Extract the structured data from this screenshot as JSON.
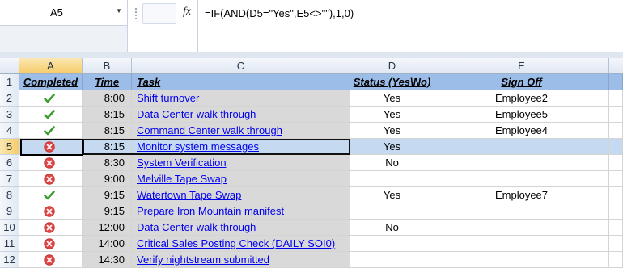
{
  "formula_bar": {
    "name_box": "A5",
    "fx_label": "fx",
    "formula": "=IF(AND(D5=\"Yes\",E5<>\"\"),1,0)"
  },
  "columns": [
    "A",
    "B",
    "C",
    "D",
    "E"
  ],
  "header_row": {
    "row_number": "1",
    "completed": "Completed",
    "time": "Time",
    "task": "Task",
    "status": "Status (Yes\\No)",
    "sign_off": "Sign Off"
  },
  "rows": [
    {
      "num": "2",
      "icon": "check",
      "time": "8:00",
      "task": "Shift turnover",
      "status": "Yes",
      "signoff": "Employee2"
    },
    {
      "num": "3",
      "icon": "check",
      "time": "8:15",
      "task": "Data Center walk through",
      "status": "Yes",
      "signoff": "Employee5"
    },
    {
      "num": "4",
      "icon": "check",
      "time": "8:15",
      "task": "Command Center walk through",
      "status": "Yes",
      "signoff": "Employee4"
    },
    {
      "num": "5",
      "icon": "x",
      "time": "8:15",
      "task": "Monitor system messages",
      "status": "Yes",
      "signoff": ""
    },
    {
      "num": "6",
      "icon": "x",
      "time": "8:30",
      "task": "System Verification",
      "status": "No",
      "signoff": ""
    },
    {
      "num": "7",
      "icon": "x",
      "time": "9:00",
      "task": "Melville Tape Swap",
      "status": "",
      "signoff": ""
    },
    {
      "num": "8",
      "icon": "check",
      "time": "9:15",
      "task": "Watertown Tape Swap",
      "status": "Yes",
      "signoff": "Employee7"
    },
    {
      "num": "9",
      "icon": "x",
      "time": "9:15",
      "task": "Prepare Iron Mountain manifest",
      "status": "",
      "signoff": ""
    },
    {
      "num": "10",
      "icon": "x",
      "time": "12:00",
      "task": "Data Center walk through",
      "status": "No",
      "signoff": ""
    },
    {
      "num": "11",
      "icon": "x",
      "time": "14:00",
      "task": "Critical Sales Posting Check (DAILY  SOI0)",
      "status": "",
      "signoff": ""
    },
    {
      "num": "12",
      "icon": "x",
      "time": "14:30",
      "task": "Verify nightstream submitted",
      "status": "",
      "signoff": ""
    }
  ],
  "colors": {
    "header_fill": "#9bbde7",
    "gray_fill": "#d9d9d9",
    "check": "#3c9b2f",
    "x": "#e04545"
  },
  "icons": {
    "check": "checkmark-icon",
    "x": "x-circle-icon"
  }
}
